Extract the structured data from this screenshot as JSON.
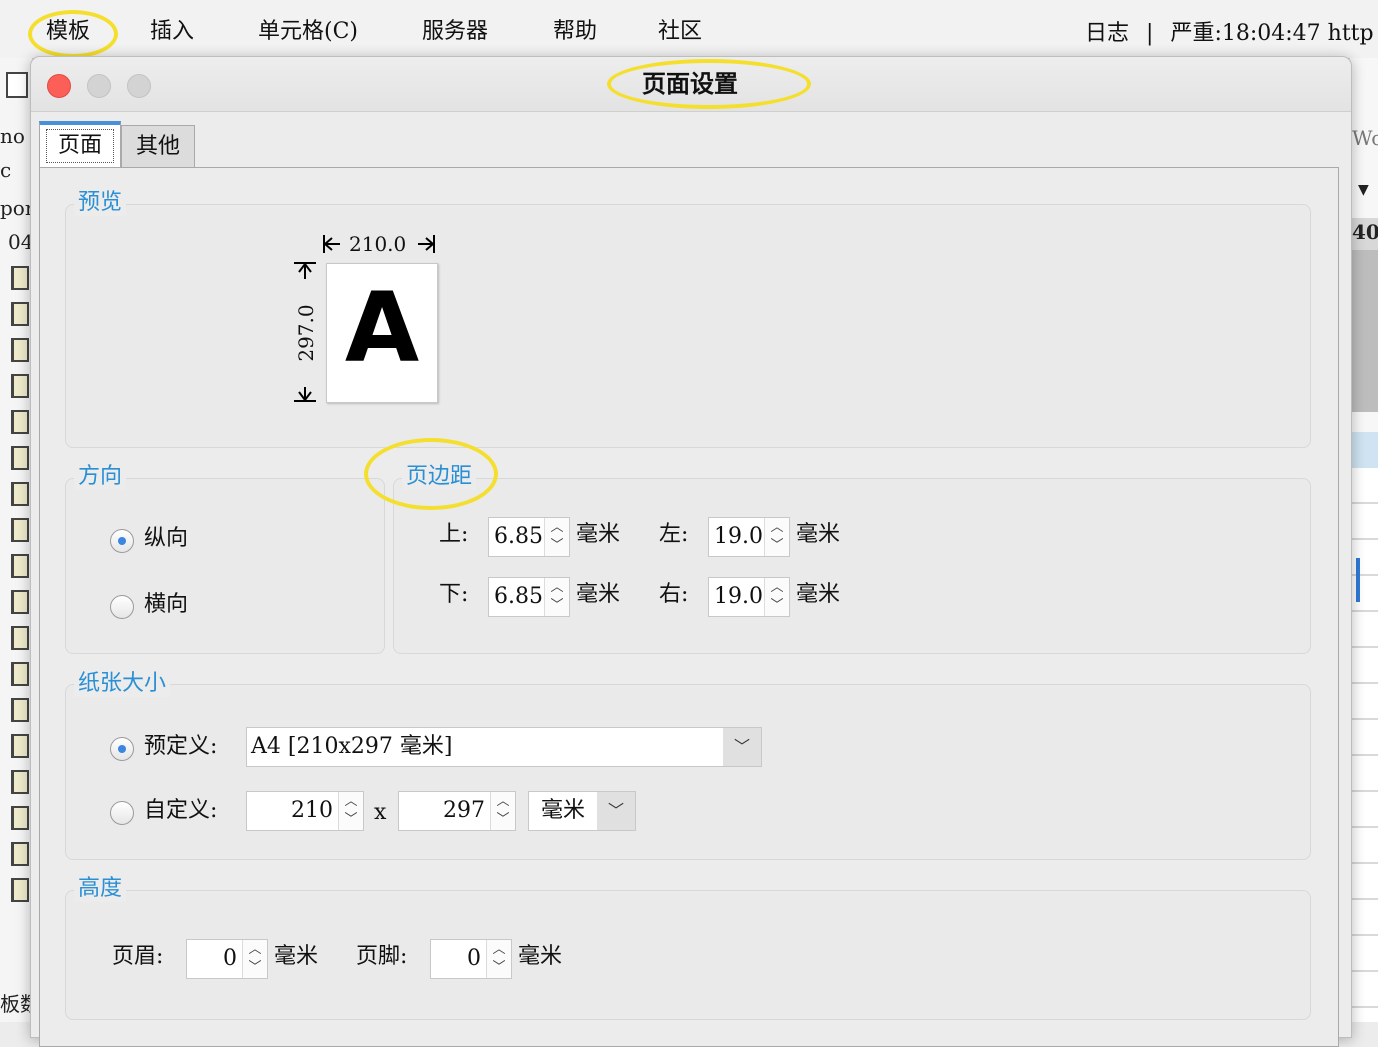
{
  "menu": {
    "items": [
      "模板",
      "插入",
      "单元格(C)",
      "服务器",
      "帮助",
      "社区"
    ],
    "log_label": "日志",
    "separator": "|",
    "status": "严重:18:04:47 http"
  },
  "background": {
    "left_fragments": [
      "no",
      "c",
      "por",
      "04"
    ],
    "bottom_fragment": "板数",
    "right_fragments": [
      "Wo",
      "40"
    ]
  },
  "dialog": {
    "title": "页面设置",
    "tabs": [
      "页面",
      "其他"
    ],
    "preview": {
      "title": "预览",
      "width": "210.0",
      "height": "297.0",
      "letter": "A"
    },
    "orientation": {
      "title": "方向",
      "portrait": "纵向",
      "landscape": "横向",
      "selected": "portrait"
    },
    "margins": {
      "title": "页边距",
      "top_label": "上:",
      "top_value": "6.85",
      "left_label": "左:",
      "left_value": "19.05",
      "bottom_label": "下:",
      "bottom_value": "6.85",
      "right_label": "右:",
      "right_value": "19.05",
      "unit": "毫米"
    },
    "paper": {
      "title": "纸张大小",
      "predefined_label": "预定义:",
      "predefined_value": "A4 [210x297 毫米]",
      "custom_label": "自定义:",
      "custom_width": "210",
      "times": "x",
      "custom_height": "297",
      "custom_unit": "毫米",
      "selected": "predefined"
    },
    "height": {
      "title": "高度",
      "header_label": "页眉:",
      "header_value": "0",
      "footer_label": "页脚:",
      "footer_value": "0",
      "unit": "毫米"
    }
  },
  "colors": {
    "accent": "#2a8fd4",
    "highlight": "#f5df2e",
    "close": "#fc5f57"
  }
}
